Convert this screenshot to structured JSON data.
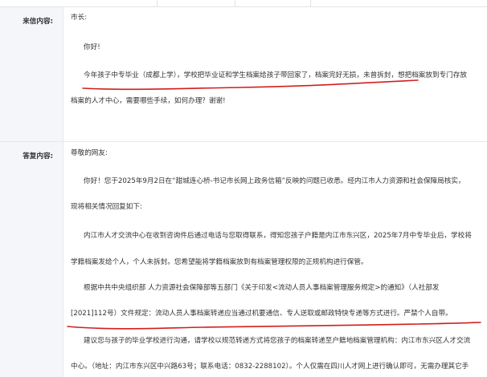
{
  "letter": {
    "label": "来信内容:",
    "lines": [
      "市长:",
      "你好!",
      "今年孩子中专毕业（成都上学），学校把毕业证和学生档案给孩子带回家了，档案完好无损，未曾拆封，想把档案放到专门存放",
      "档案的人才中心，需要哪些手续，如何办理？谢谢!"
    ]
  },
  "reply": {
    "label": "答复内容:",
    "lines": [
      "尊敬的网友:",
      "你好！您于2025年9月2日在“甜城连心桥-书记市长网上政务信箱”反映的问题已收悉。经内江市人力资源和社会保障局核实，",
      "现将相关情况回复如下:",
      "内江市人才交流中心在收到咨询件后通过电话与您取得联系，得知您孩子户籍是内江市东兴区，2025年7月中专毕业后，学校将",
      "学籍档案发给个人，个人未拆封。您希望能将学籍档案放到有档案管理权限的正规机构进行保管。",
      "根据中共中央组织部 人力资源社会保障部等五部门《关于印发<流动人员人事档案管理服务规定>的通知》（人社部发",
      "[2021]112号）文件规定：流动人员人事档案转递应当通过机要通信、专人送取或邮政特快专递等方式进行。严禁个人自带。",
      "建议您与孩子的毕业学校进行沟通，请学校以规范转递方式将您孩子的档案转递至户籍地档案管理机构：内江市东兴区人才交流",
      "中心。（地址：内江市东兴区中兴路63号；联系电话：0832-2288102）。个人仅需在四川人才网上进行确认即可，无需办理其它手"
    ]
  },
  "colors": {
    "label_bg": "#f5f6f9",
    "border": "#e6e8ee",
    "text": "#333333",
    "annotation": "#d21e1e"
  }
}
